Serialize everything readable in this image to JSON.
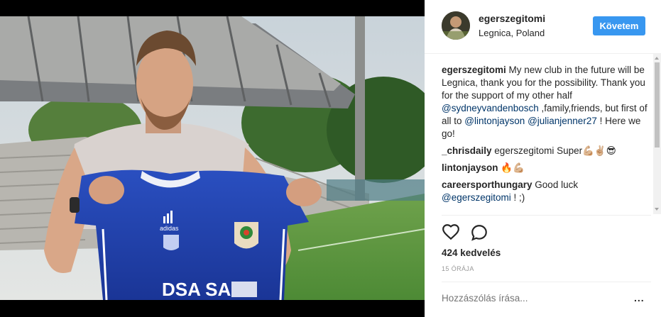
{
  "post": {
    "username": "egerszegitomi",
    "location": "Legnica, Poland",
    "follow_label": "Követem",
    "likes": "424 kedvelés",
    "time": "15 ÓRÁJA",
    "add_comment_placeholder": "Hozzászólás írása...",
    "more_label": "..."
  },
  "photo": {
    "jersey_sponsor": "DSA SA",
    "jersey_brand": "adidas"
  },
  "caption": {
    "username": "egerszegitomi",
    "text_1": " My new club in the future will be Legnica, thank you for the possibility. Thank you for the support of my other half ",
    "mention_1": "@sydneyvandenbosch",
    "text_2": " ,family,friends, but first of all to ",
    "mention_2": "@lintonjayson",
    "text_3": " ",
    "mention_3": "@julianjenner27",
    "text_4": " ! Here we go!"
  },
  "comments": [
    {
      "username": "_chrisdaily",
      "text": " egerszegitomi Super💪🏼✌🏼😎"
    },
    {
      "username": "lintonjayson",
      "text": " 🔥💪🏼"
    },
    {
      "username": "careersporthungary",
      "text": " Good luck ",
      "mention": "@egerszegitomi",
      "text_after": " ! ;)"
    }
  ],
  "colors": {
    "accent": "#3897f0",
    "mention": "#003569",
    "jersey": "#1d3ea8"
  },
  "icons": {
    "like": "heart-icon",
    "comment": "comment-icon",
    "options": "more-icon"
  }
}
